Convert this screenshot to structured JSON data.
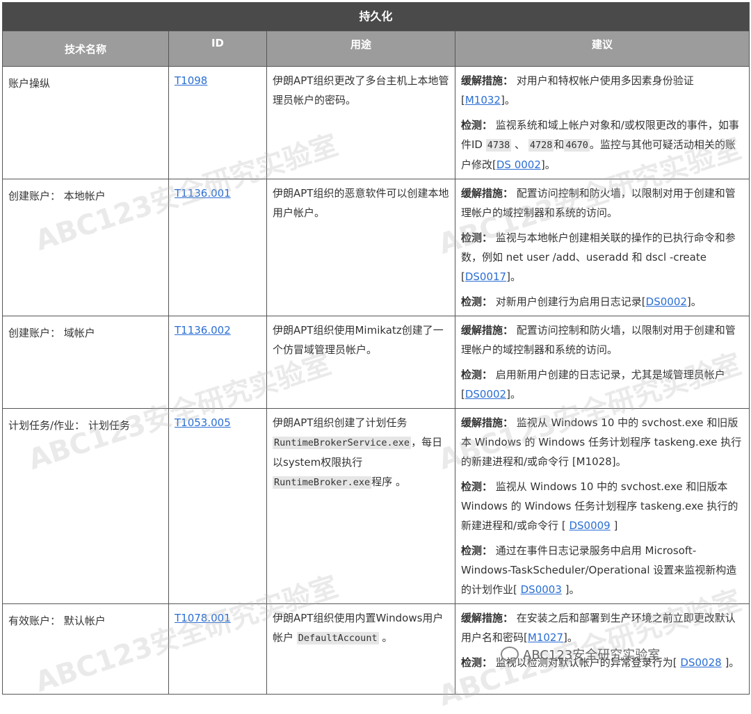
{
  "title": "持久化",
  "headers": [
    "技术名称",
    "ID",
    "用途",
    "建议"
  ],
  "rows": [
    {
      "name": "账户操纵",
      "id": "T1098",
      "usage": "伊朗APT组织更改了多台主机上本地管理员帐户的密码。",
      "advice": [
        {
          "label": "缓解措施：",
          "text": " 对用户和特权帐户使用多因素身份验证",
          "link": "M1032",
          "after": "。"
        },
        {
          "label": "检测：",
          "text_a": " 监视系统和域上帐户对象和/或权限更改的事件，如事件ID ",
          "code1": "4738",
          "mid1": " 、 ",
          "code2": "4728",
          "mid2": "和",
          "code3": "4670",
          "text_b": "。监控与其他可疑活动相关的账户修改",
          "link": "DS 0002",
          "after": "。"
        }
      ]
    },
    {
      "name": "创建账户： 本地帐户",
      "id": "T1136.001",
      "usage": "伊朗APT组织的恶意软件可以创建本地用户帐户。",
      "advice": [
        {
          "label": "缓解措施：",
          "text": " 配置访问控制和防火墙，以限制对用于创建和管理帐户的域控制器和系统的访问。"
        },
        {
          "label": "检测：",
          "text": " 监视与本地帐户创建相关联的操作的已执行命令和参数，例如 net user /add、useradd 和 dscl -create ",
          "link": "DS0017",
          "after": "。"
        },
        {
          "label": "检测：",
          "text": " 对新用户创建行为启用日志记录",
          "link": "DS0002",
          "after": "。"
        }
      ]
    },
    {
      "name": "创建账户： 域帐户",
      "id": "T1136.002",
      "usage": "伊朗APT组织使用Mimikatz创建了一个仿冒域管理员帐户。",
      "advice": [
        {
          "label": "缓解措施：",
          "text": " 配置访问控制和防火墙，以限制对用于创建和管理帐户的域控制器和系统的访问。"
        },
        {
          "label": "检测：",
          "text": " 启用新用户创建的日志记录，尤其是域管理员帐户",
          "link": "DS0002",
          "after": "。"
        }
      ]
    },
    {
      "name": "计划任务/作业： 计划任务",
      "id": "T1053.005",
      "usage_a": "伊朗APT组织创建了计划任务",
      "usage_code1": "RuntimeBrokerService.exe",
      "usage_b": "，每日以system权限执行",
      "usage_code2": "RuntimeBroker.exe",
      "usage_c": "程序 。",
      "advice": [
        {
          "label": "缓解措施：",
          "text": " 监视从 Windows 10 中的 svchost.exe 和旧版本 Windows 的 Windows 任务计划程序 taskeng.exe 执行的新建进程和/或命令行 [M1028]。"
        },
        {
          "label": "检测：",
          "text": " 监视从 Windows 10 中的 svchost.exe 和旧版本 Windows 的 Windows 任务计划程序 taskeng.exe 执行的新建进程和/或命令行 [ ",
          "link": "DS0009",
          "after": " ]"
        },
        {
          "label": "检测：",
          "text": " 通过在事件日志记录服务中启用 Microsoft-Windows-TaskScheduler/Operational 设置来监视新构造的计划作业[ ",
          "link": "DS0003",
          "after": " ]。"
        }
      ]
    },
    {
      "name": "有效账户： 默认帐户",
      "id": "T1078.001",
      "usage_a": "伊朗APT组织使用内置Windows用户帐户 ",
      "usage_code1": "DefaultAccount",
      "usage_b": " 。",
      "advice": [
        {
          "label": "缓解措施：",
          "text": " 在安装之后和部署到生产环境之前立即更改默认用户名和密码",
          "link": "M1027",
          "after": "。"
        },
        {
          "label": "检测：",
          "text": " 监视以检测对默认帐户的异常登录行为",
          "link": "DS0028",
          "after": " ]。",
          "pre_link": "[ "
        }
      ]
    }
  ],
  "watermark": "ABC123安全研究实验室"
}
